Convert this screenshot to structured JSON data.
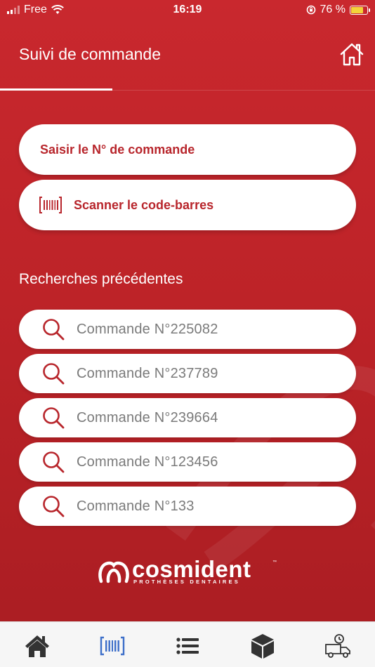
{
  "status_bar": {
    "carrier": "Free",
    "time": "16:19",
    "battery_percent": "76 %"
  },
  "header": {
    "title": "Suivi de commande"
  },
  "actions": {
    "enter_number_label": "Saisir le N° de commande",
    "scan_barcode_label": "Scanner le code-barres"
  },
  "previous_searches": {
    "title": "Recherches précédentes",
    "items": [
      {
        "label": "Commande N°225082"
      },
      {
        "label": "Commande N°237789"
      },
      {
        "label": "Commande N°239664"
      },
      {
        "label": "Commande N°123456"
      },
      {
        "label": "Commande N°133"
      }
    ]
  },
  "logo": {
    "name": "cosmident",
    "tagline": "PROTHÈSES DENTAIRES",
    "trademark": "™"
  },
  "tabbar": {
    "tabs": [
      {
        "icon": "home-icon",
        "active": false
      },
      {
        "icon": "barcode-icon",
        "active": true
      },
      {
        "icon": "list-icon",
        "active": false
      },
      {
        "icon": "box-icon",
        "active": false
      },
      {
        "icon": "delivery-truck-icon",
        "active": false
      }
    ]
  },
  "colors": {
    "brand_red": "#c9282e",
    "button_text": "#b8262c",
    "active_tab": "#3d6fc9",
    "inactive_tab": "#333333"
  }
}
